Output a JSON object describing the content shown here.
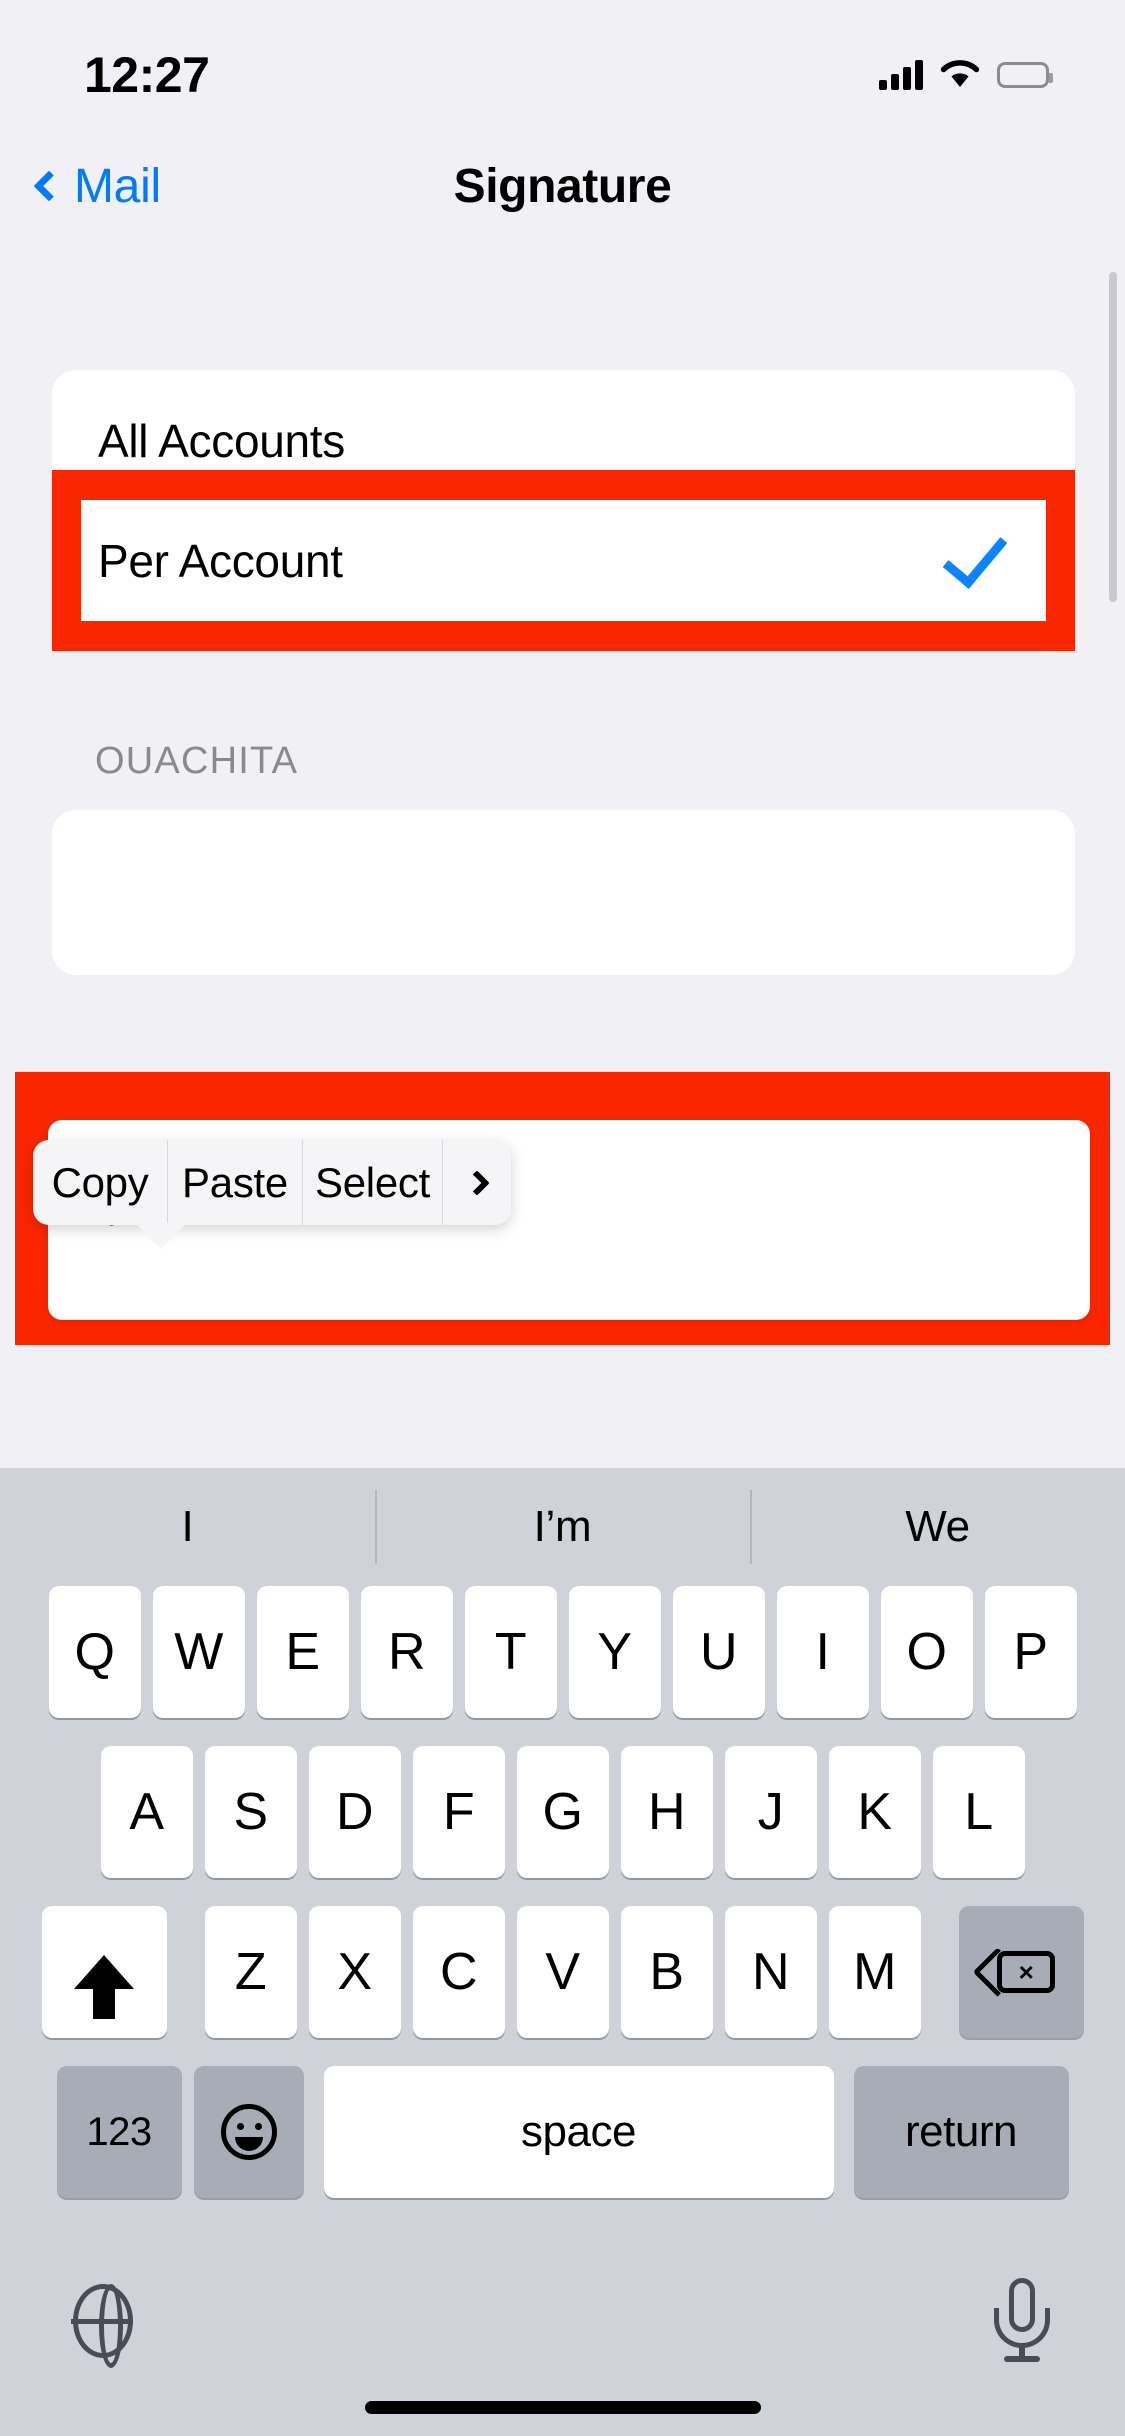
{
  "status_bar": {
    "time": "12:27",
    "cellular_icon": "signal-bars-icon",
    "wifi_icon": "wifi-icon",
    "battery_icon": "battery-icon"
  },
  "nav_bar": {
    "back_label": "Mail",
    "back_icon": "chevron-left-icon",
    "title": "Signature"
  },
  "accounts_group": {
    "options": [
      {
        "label": "All Accounts",
        "selected": false
      },
      {
        "label": "Per Account",
        "selected": true
      }
    ],
    "checkmark_icon": "checkmark-icon",
    "accent_color": "#0A84FF"
  },
  "signature_section": {
    "header": "OUACHITA",
    "field_value": "",
    "caret_visible": true
  },
  "edit_menu": {
    "items": [
      {
        "label": "Copy"
      },
      {
        "label": "Paste"
      },
      {
        "label": "Select"
      }
    ],
    "more_icon": "chevron-right-icon"
  },
  "annotations": {
    "highlight_color": "#FA2600",
    "boxes": [
      {
        "target": "per-account-row"
      },
      {
        "target": "signature-editor"
      }
    ]
  },
  "keyboard": {
    "predictions": [
      "I",
      "I’m",
      "We"
    ],
    "row1": [
      "Q",
      "W",
      "E",
      "R",
      "T",
      "Y",
      "U",
      "I",
      "O",
      "P"
    ],
    "row2": [
      "A",
      "S",
      "D",
      "F",
      "G",
      "H",
      "J",
      "K",
      "L"
    ],
    "row3": [
      "Z",
      "X",
      "C",
      "V",
      "B",
      "N",
      "M"
    ],
    "shift_icon": "shift-arrow-up-icon",
    "delete_icon": "delete-backward-icon",
    "numeric_label": "123",
    "emoji_icon": "emoji-smiley-icon",
    "space_label": "space",
    "return_label": "return",
    "globe_icon": "globe-icon",
    "mic_icon": "microphone-icon"
  }
}
